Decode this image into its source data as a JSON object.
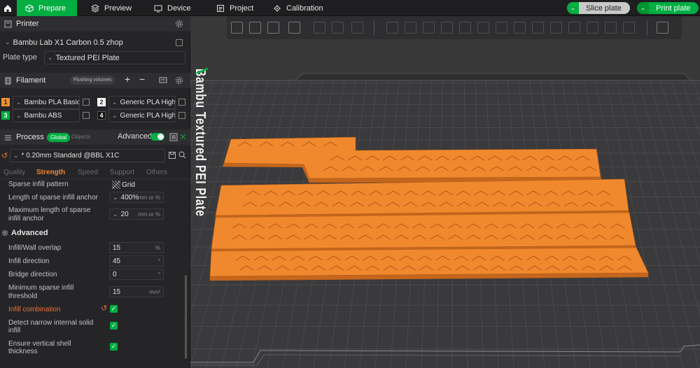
{
  "topbar": {
    "tabs": [
      {
        "label": "Prepare",
        "icon": "cube-icon"
      },
      {
        "label": "Preview",
        "icon": "preview-icon"
      },
      {
        "label": "Device",
        "icon": "monitor-icon"
      },
      {
        "label": "Project",
        "icon": "project-icon"
      },
      {
        "label": "Calibration",
        "icon": "calibration-icon"
      }
    ],
    "slice_label": "Slice plate",
    "print_label": "Print plate"
  },
  "printer": {
    "section_title": "Printer",
    "name": "Bambu Lab X1 Carbon 0.5 zhop",
    "plate_type_label": "Plate type",
    "plate_type_value": "Textured PEI Plate"
  },
  "filament": {
    "section_title": "Filament",
    "flushing_label": "Flushing volumes",
    "slots": [
      {
        "num": "1",
        "name": "Bambu PLA Basic",
        "color": "#f0902c"
      },
      {
        "num": "2",
        "name": "Generic PLA High...",
        "color": "#ffffff"
      },
      {
        "num": "3",
        "name": "Bambu ABS",
        "color": "#00ae42"
      },
      {
        "num": "4",
        "name": "Generic PLA High...",
        "color": "#111111"
      }
    ]
  },
  "process": {
    "section_title": "Process",
    "global_label": "Global",
    "objects_label": "Objects",
    "advanced_label": "Advanced",
    "preset": "* 0.20mm Standard @BBL X1C",
    "subtabs": [
      "Quality",
      "Strength",
      "Speed",
      "Support",
      "Others"
    ],
    "active_subtab": "Strength"
  },
  "settings": {
    "sparse_pattern_label": "Sparse infill pattern",
    "sparse_pattern_value": "Grid",
    "anchor_label": "Length of sparse infill anchor",
    "anchor_value": "400%",
    "anchor_unit": "mm or %",
    "max_anchor_label_1": "Maximum length of sparse",
    "max_anchor_label_2": "infill anchor",
    "max_anchor_value": "20",
    "max_anchor_unit": "mm or %",
    "advanced_heading": "Advanced",
    "wall_overlap_label": "Infill/Wall overlap",
    "wall_overlap_value": "15",
    "wall_overlap_unit": "%",
    "infill_dir_label": "Infill direction",
    "infill_dir_value": "45",
    "infill_dir_unit": "°",
    "bridge_dir_label": "Bridge direction",
    "bridge_dir_value": "0",
    "bridge_dir_unit": "°",
    "min_sparse_label_1": "Minimum sparse infill",
    "min_sparse_label_2": "threshold",
    "min_sparse_value": "15",
    "min_sparse_unit": "mm²",
    "infill_comb_label": "Infill combination",
    "infill_comb_checked": true,
    "detect_label_1": "Detect narrow internal solid",
    "detect_label_2": "infill",
    "detect_checked": true,
    "ensure_label_1": "Ensure vertical shell",
    "ensure_label_2": "thickness",
    "ensure_checked": true
  },
  "viewport": {
    "plate_text": "Bambu Textured PEI Plate",
    "part_color": "#f0892e"
  },
  "colors": {
    "accent": "#00ae42",
    "modified": "#f07033",
    "active_tab": "#f08533"
  }
}
